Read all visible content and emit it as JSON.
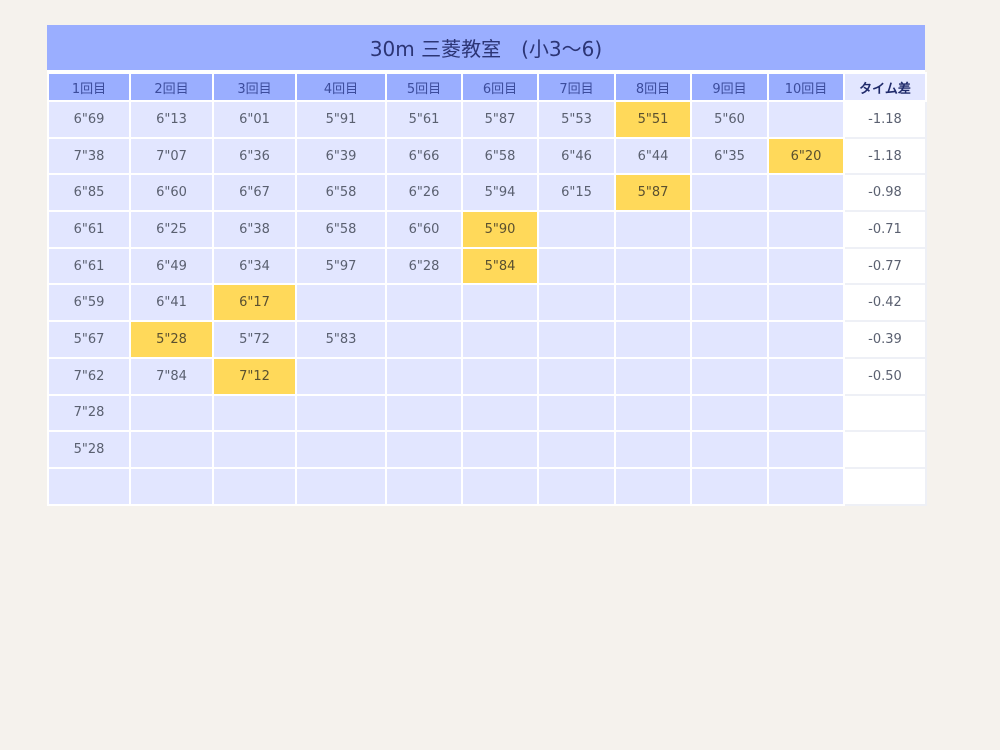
{
  "title": "30m 三菱教室　(小3〜6)",
  "headers": [
    "1回目",
    "2回目",
    "3回目",
    "4回目",
    "5回目",
    "6回目",
    "7回目",
    "8回目",
    "9回目",
    "10回目",
    "タイム差"
  ],
  "rows": [
    {
      "times": [
        "6\"69",
        "6\"13",
        "6\"01",
        "5\"91",
        "5\"61",
        "5\"87",
        "5\"53",
        "5\"51",
        "5\"60",
        ""
      ],
      "best_index": 7,
      "diff": "-1.18"
    },
    {
      "times": [
        "7\"38",
        "7\"07",
        "6\"36",
        "6\"39",
        "6\"66",
        "6\"58",
        "6\"46",
        "6\"44",
        "6\"35",
        "6\"20"
      ],
      "best_index": 9,
      "diff": "-1.18"
    },
    {
      "times": [
        "6\"85",
        "6\"60",
        "6\"67",
        "6\"58",
        "6\"26",
        "5\"94",
        "6\"15",
        "5\"87",
        "",
        ""
      ],
      "best_index": 7,
      "diff": "-0.98"
    },
    {
      "times": [
        "6\"61",
        "6\"25",
        "6\"38",
        "6\"58",
        "6\"60",
        "5\"90",
        "",
        "",
        "",
        ""
      ],
      "best_index": 5,
      "diff": "-0.71"
    },
    {
      "times": [
        "6\"61",
        "6\"49",
        "6\"34",
        "5\"97",
        "6\"28",
        "5\"84",
        "",
        "",
        "",
        ""
      ],
      "best_index": 5,
      "diff": "-0.77"
    },
    {
      "times": [
        "6\"59",
        "6\"41",
        "6\"17",
        "",
        "",
        "",
        "",
        "",
        "",
        ""
      ],
      "best_index": 2,
      "diff": "-0.42"
    },
    {
      "times": [
        "5\"67",
        "5\"28",
        "5\"72",
        "5\"83",
        "",
        "",
        "",
        "",
        "",
        ""
      ],
      "best_index": 1,
      "diff": "-0.39"
    },
    {
      "times": [
        "7\"62",
        "7\"84",
        "7\"12",
        "",
        "",
        "",
        "",
        "",
        "",
        ""
      ],
      "best_index": 2,
      "diff": "-0.50"
    },
    {
      "times": [
        "7\"28",
        "",
        "",
        "",
        "",
        "",
        "",
        "",
        "",
        ""
      ],
      "best_index": -1,
      "diff": ""
    },
    {
      "times": [
        "5\"28",
        "",
        "",
        "",
        "",
        "",
        "",
        "",
        "",
        ""
      ],
      "best_index": -1,
      "diff": ""
    },
    {
      "times": [
        "",
        "",
        "",
        "",
        "",
        "",
        "",
        "",
        "",
        ""
      ],
      "best_index": -1,
      "diff": ""
    }
  ],
  "colors": {
    "header_bg": "#9aaeff",
    "cell_bg": "#e2e6ff",
    "best_highlight": "#ffd95a",
    "diff_bg": "#ffffff",
    "page_bg": "#f5f2ed"
  }
}
